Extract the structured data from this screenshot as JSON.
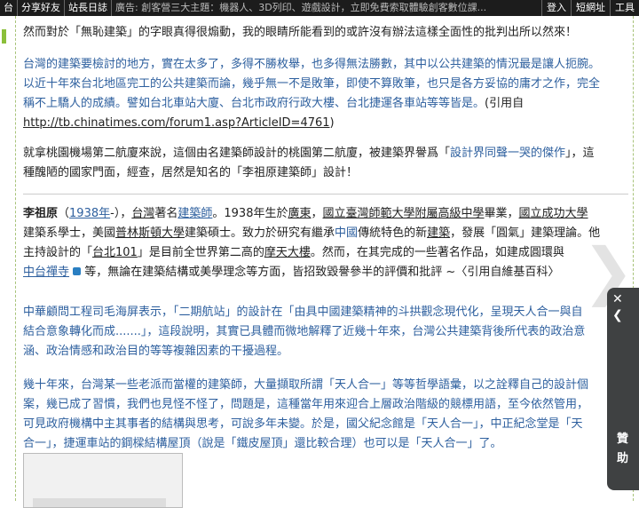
{
  "topbar": {
    "left_cut": "台",
    "share": "分享好友",
    "news": "站長日誌",
    "ad": "廣告: 創客營三大主題：機器人、3D列印、遊戲設計，立即免費索取體驗創客數位課...",
    "login": "登入",
    "short_url": "短網址",
    "tools": "工具"
  },
  "article": {
    "p1": "然而對於「無恥建築」的字眼真得很煽動，我的眼睛所能看到的或許沒有辦法這樣全面性的批判出所以然來！",
    "p2": {
      "l1": "台灣的建築要檢討的地方，實在太多了，多得不勝枚舉，也多得無法勝數，其中以公共建築的情況最是讓人扼腕。",
      "l2": "以近十年來台北地區完工的公共建築而論，幾乎無一不是敗筆，即使不算敗筆，也只是各方妥協的庸才之作，完全",
      "l3": "稱不上驕人的成績。譬如台北車站大廈、台北市政府行政大樓、台北捷運各車站等等皆是。",
      "cite": "(引用自",
      "url": "http://tb.chinatimes.com/forum1.asp?ArticleID=4761",
      "close": ")"
    },
    "p3": {
      "l1a": " 就拿桃園機場第二航廈來說，這個由名建築師設計的桃園第二航廈，被建築界譽爲「",
      "l1b": "設計界同聲一哭的傑作",
      "l1c": "」，這",
      "l2": "種醜陋的國家門面，經查，居然是知名的「李祖原建築師」設計！"
    },
    "p4": {
      "name": "李祖原",
      "year": "1938年",
      "s1": "-），",
      "tw": "台灣",
      "s2": "著名",
      "arch": "建築師",
      "s3": "。1938年生於",
      "gd": "廣東",
      "s4": "，",
      "ntnu": "國立臺灣師範大學附屬高級中學",
      "s5": "畢業，",
      "ncku": "國立成功大學",
      "l2a": "建築系學士，美國",
      "princeton": "普林斯頓大學",
      "l2b": "建築碩士。致力於研究有繼承",
      "cn": "中國",
      "l2c": "傳統特色的新",
      "jz": "建築",
      "l2d": "，發展「圓氣」建築理論。他",
      "l3a": "主持設計的「",
      "t101": "台北101",
      "l3b": "」是目前全世界第二高的",
      "skyscraper": "摩天大樓",
      "l3c": "。然而，在其完成的一些著名作品，如建成圓環與",
      "zt": "中台禪寺",
      "l4": " 等，無論在建築結構或美學理念等方面，皆招致毀譽參半的評價和批評 ~〈引用自維基百科〉"
    },
    "p5": {
      "l1": "中華顧問工程司毛海屏表示，「二期航站」的設計在「由具中國建築精神的斗拱觀念現代化，呈現天人合一與自",
      "l2": "結合意象轉化而成.......」，這段說明，其實已具體而微地解釋了近幾十年來，台灣公共建築背後所代表的政治意",
      "l3": "涵、政治情感和政治目的等等複雜因素的干擾過程。"
    },
    "p6": {
      "l1": "幾十年來，台灣某一些老派而當權的建築師，大量擷取所謂「天人合一」等等哲學語彙，以之詮釋自己的設計個",
      "l2": "案，幾已成了習慣，我們也見怪不怪了，問題是，這種當年用來迎合上層政治階級的競標用語，至今依然管用，",
      "l3": "可見政府機構中主其事者的結構與思考，可說多年未變。於是，國父紀念館是「天人合一」，中正紀念堂是「天",
      "l4": "合一」，捷運車站的鋼樑結構屋頂（說是「鐵皮屋頂」還比較合理）也可以是「天人合一」了。"
    }
  },
  "side": {
    "close": "✕",
    "back": "❮",
    "label1": "贊",
    "label2": "助"
  },
  "next_arrow": "❯"
}
